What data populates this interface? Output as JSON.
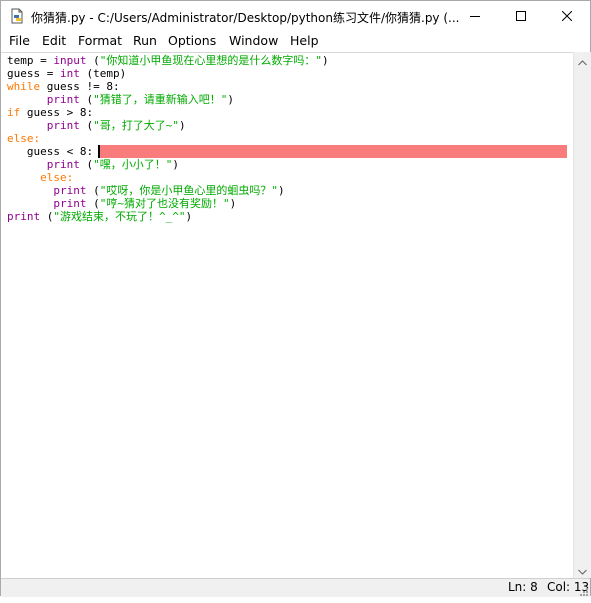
{
  "window": {
    "title": "你猜猜.py - C:/Users/Administrator/Desktop/python练习文件/你猜猜.py (..."
  },
  "menu": [
    "File",
    "Edit",
    "Format",
    "Run",
    "Options",
    "Window",
    "Help"
  ],
  "code": [
    [
      {
        "t": "temp = ",
        "c": ""
      },
      {
        "t": "input",
        "c": "bi"
      },
      {
        "t": " (",
        "c": ""
      },
      {
        "t": "\"你知道小甲鱼现在心里想的是什么数字吗：\"",
        "c": "str"
      },
      {
        "t": ")",
        "c": ""
      }
    ],
    [
      {
        "t": "guess = ",
        "c": ""
      },
      {
        "t": "int",
        "c": "bi"
      },
      {
        "t": " (temp)",
        "c": ""
      }
    ],
    [
      {
        "t": "while",
        "c": "kw"
      },
      {
        "t": " guess != 8:",
        "c": ""
      }
    ],
    [
      {
        "t": "      ",
        "c": ""
      },
      {
        "t": "print",
        "c": "bi"
      },
      {
        "t": " (",
        "c": ""
      },
      {
        "t": "\"猜错了，请重新输入吧！\"",
        "c": "str"
      },
      {
        "t": ")",
        "c": ""
      }
    ],
    [
      {
        "t": "if",
        "c": "kw"
      },
      {
        "t": " guess > 8:",
        "c": ""
      }
    ],
    [
      {
        "t": "      ",
        "c": ""
      },
      {
        "t": "print",
        "c": "bi"
      },
      {
        "t": " (",
        "c": ""
      },
      {
        "t": "\"哥，打了大了~\"",
        "c": "str"
      },
      {
        "t": ")",
        "c": ""
      }
    ],
    [
      {
        "t": "else:",
        "c": "kw"
      }
    ],
    [
      {
        "t": "   guess < 8:",
        "c": ""
      }
    ],
    [
      {
        "t": "      ",
        "c": ""
      },
      {
        "t": "print",
        "c": "bi"
      },
      {
        "t": " (",
        "c": ""
      },
      {
        "t": "\"嘿，小小了！\"",
        "c": "str"
      },
      {
        "t": ")",
        "c": ""
      }
    ],
    [
      {
        "t": "     ",
        "c": ""
      },
      {
        "t": "else:",
        "c": "kw"
      }
    ],
    [
      {
        "t": "       ",
        "c": ""
      },
      {
        "t": "print",
        "c": "bi"
      },
      {
        "t": " (",
        "c": ""
      },
      {
        "t": "\"哎呀，你是小甲鱼心里的蛔虫吗？\"",
        "c": "str"
      },
      {
        "t": ")",
        "c": ""
      }
    ],
    [
      {
        "t": "       ",
        "c": ""
      },
      {
        "t": "print",
        "c": "bi"
      },
      {
        "t": " (",
        "c": ""
      },
      {
        "t": "\"哼~猜对了也没有奖励！\"",
        "c": "str"
      },
      {
        "t": ")",
        "c": ""
      }
    ],
    [
      {
        "t": "print",
        "c": "bi"
      },
      {
        "t": " (",
        "c": ""
      },
      {
        "t": "\"游戏结束，不玩了！^_^\"",
        "c": "str"
      },
      {
        "t": ")",
        "c": ""
      }
    ]
  ],
  "status": {
    "ln": "Ln: 8",
    "col": "Col: 13"
  },
  "colors": {
    "keyword": "#ff7700",
    "builtin": "#900090",
    "string": "#00aa00",
    "highlight": "#f87c7c"
  },
  "icons": {
    "app": "python-idle-icon",
    "minimize": "minimize-icon",
    "maximize": "maximize-icon",
    "close": "close-icon"
  }
}
